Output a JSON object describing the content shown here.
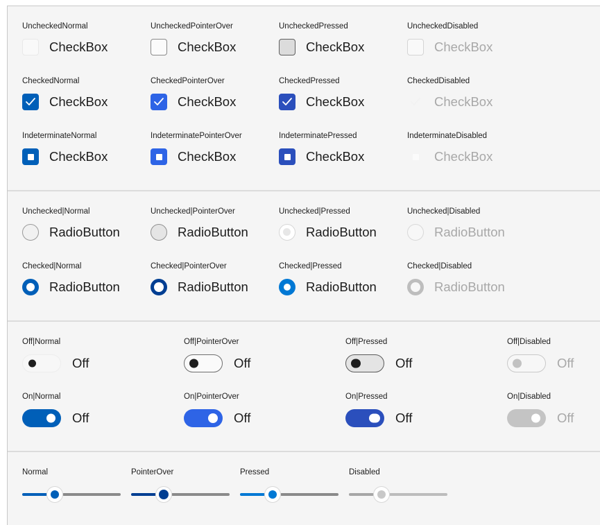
{
  "colors": {
    "accent": "#005fb8",
    "accent_over": "#2e64e6",
    "accent_pressed": "#2b4fbc",
    "disabled": "#c4c4c4",
    "slider_dark": "#003e92",
    "slider_light": "#0078d4"
  },
  "checkbox_label": "CheckBox",
  "radio_label": "RadioButton",
  "toggle_label": "Off",
  "checkboxes": {
    "unchecked": [
      "UncheckedNormal",
      "UncheckedPointerOver",
      "UncheckedPressed",
      "UncheckedDisabled"
    ],
    "checked": [
      "CheckedNormal",
      "CheckedPointerOver",
      "CheckedPressed",
      "CheckedDisabled"
    ],
    "indeterminate": [
      "IndeterminateNormal",
      "IndeterminatePointerOver",
      "IndeterminatePressed",
      "IndeterminateDisabled"
    ]
  },
  "radios": {
    "unchecked": [
      "Unchecked|Normal",
      "Unchecked|PointerOver",
      "Unchecked|Pressed",
      "Unchecked|Disabled"
    ],
    "checked": [
      "Checked|Normal",
      "Checked|PointerOver",
      "Checked|Pressed",
      "Checked|Disabled"
    ]
  },
  "toggles": {
    "off": [
      "Off|Normal",
      "Off|PointerOver",
      "Off|Pressed",
      "Off|Disabled"
    ],
    "on": [
      "On|Normal",
      "On|PointerOver",
      "On|Pressed",
      "On|Disabled"
    ]
  },
  "sliders": {
    "captions": [
      "Normal",
      "PointerOver",
      "Pressed",
      "Disabled"
    ],
    "value_fraction": [
      0.33,
      0.33,
      0.33,
      0.33
    ]
  }
}
